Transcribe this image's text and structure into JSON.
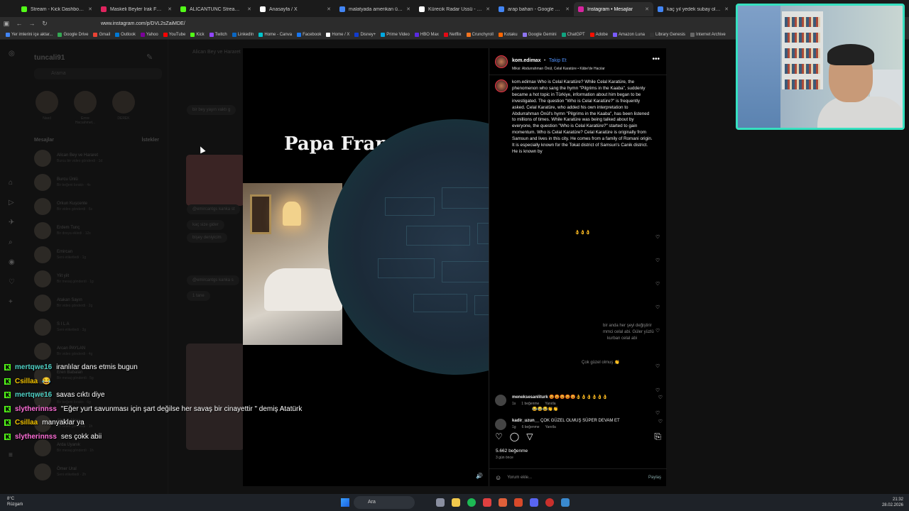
{
  "browser": {
    "tabs": [
      {
        "label": "Stream - Kick Dashboard",
        "color": "#53fc18",
        "active": false
      },
      {
        "label": "Maskeli Beyler Irak Fakir Yar",
        "color": "#e0245e",
        "active": false
      },
      {
        "label": "ALICANTUNC Stream - Wat",
        "color": "#53fc18",
        "active": false
      },
      {
        "label": "Anasayfa / X",
        "color": "#ffffff",
        "active": false
      },
      {
        "label": "malatyada amerikan üssü - Goo",
        "color": "#4285f4",
        "active": false
      },
      {
        "label": "Kürecik Radar Üssü - Vikipedi",
        "color": "#ffffff",
        "active": false
      },
      {
        "label": "arap baharı - Google Search",
        "color": "#4285f4",
        "active": false
      },
      {
        "label": "Instagram • Mesajlar",
        "color": "#d6249f",
        "active": true
      },
      {
        "label": "kaç yıl yedek subay olarak çıkar",
        "color": "#4285f4",
        "active": false
      }
    ],
    "url": "www.instagram.com/p/DVL2sZaiMDE/",
    "bookmarks": [
      "Yer imlerini içe aktar...",
      "Google Drive",
      "Gmail",
      "Outlook",
      "Yahoo",
      "YouTube",
      "Kick",
      "Twitch",
      "LinkedIn",
      "Home - Canva",
      "Facebook",
      "Home / X",
      "Disney+",
      "Prime Video",
      "HBO Max",
      "Netflix",
      "Crunchyroll",
      "Kotaku",
      "Google Gemini",
      "ChatGPT",
      "Adobe",
      "Amazon Luna",
      "Library Genesis",
      "Internet Archive"
    ]
  },
  "inbox": {
    "username": "tuncali91",
    "search_placeholder": "Arama",
    "notes": [
      {
        "label": "Nasıl"
      },
      {
        "label": "Emre Hacıahmet..."
      },
      {
        "label": "DEREK"
      }
    ],
    "messages_header": "Mesajlar",
    "requests_label": "İstekler",
    "chats": [
      {
        "name": "Alican Bey ve Hararet",
        "sub": "Burcu bir video gönderdi · 1d"
      },
      {
        "name": "Burcu Ünlü",
        "sub": "Bir beğeni bıraktı · 4s"
      },
      {
        "name": "Orkun Kuşcente",
        "sub": "Bir video gönderdi · 6s"
      },
      {
        "name": "Erdem Tunç",
        "sub": "Bir dosya ekledi · 12s"
      },
      {
        "name": "Emircan",
        "sub": "Seni etiketledi · 1g"
      },
      {
        "name": "Yiit yiit",
        "sub": "Bir mesaj gönderdi · 1g"
      },
      {
        "name": "Atakan Sayın",
        "sub": "Bir video gönderdi · 2g"
      },
      {
        "name": "S I L A",
        "sub": "Seni etiketledi · 3g"
      },
      {
        "name": "Arcan PAYLAN",
        "sub": "Bir video gönderdi · 4g"
      },
      {
        "name": "Eren Babalan",
        "sub": "Bir mesaj gönderdi · 5g"
      },
      {
        "name": "Hakan",
        "sub": "Bir beğeni bıraktı · 6g"
      },
      {
        "name": "Ahmet Aksu",
        "sub": "Bir video gönderdi · 1h"
      },
      {
        "name": "Arda Uyanık",
        "sub": "Bir mesaj gönderdi · 1h"
      },
      {
        "name": "Ömer Ural",
        "sub": "Seni etiketledi · 2h"
      }
    ]
  },
  "thread": {
    "title": "Alican Bey ve Hararet",
    "bubbles": [
      "bir bey yayın vaktı g",
      "@emircantgs kanka st",
      "kaç size gider",
      "bişey deniyicim",
      "@emircantgs kanka s",
      "1 tane"
    ]
  },
  "video": {
    "overlay_text": "Papa Franc"
  },
  "post": {
    "author": "kom.edimax",
    "follow_label": "Takip Et",
    "music": "Miksi: Abdurrahman Önül, Celal Karatüre • Kâbe'de Hacılar",
    "caption": "kom.edimax Who is Celal Karatüre? While Celal Karatüre, the phenomenon who sang the hymn \"Pilgrims in the Kaaba\", suddenly became a hot topic in Türkiye, information about him began to be investigated. The question \"Who is Celal Karatüre?\" is frequently asked. Celal Karatüre, who added his own interpretation to Abdurrahman Önül's hymn \"Pilgrims in the Kaaba\", has been listened to millions of times. While Karatüre was being talked about by everyone, the question \"Who is Celal Karatüre?\" started to gain momentum. Who is Celal Karatüre? Celal Karatüre is originally from Samsun and lives in this city. He comes from a family of Romani origin. It is especially known for the Tokat district of Samsun's Canik district. He is known by",
    "faded_comments": [
      "👌👌👌",
      "bir anda her şeyi değiştirir",
      "mmci celal abi. Güler yüzlü",
      "kurban celal abi",
      "Çok güzel olmuş 👏",
      "😂😂😂👏👏"
    ],
    "comments": [
      {
        "user": "meneksesanliturk",
        "text": "😡😡😡😡😡👌👌👌👌👌👌",
        "meta": "1s",
        "likes": "1 beğenme",
        "reply": "Yanıtla"
      },
      {
        "user": "kadir_uzun__",
        "text": "ÇOK GÜZEL OLMUŞ SÜPER DEVAM ET",
        "meta": "1g",
        "likes": "6 beğenme",
        "reply": "Yanıtla"
      }
    ],
    "likes": "5.662 beğenme",
    "time_ago": "3 gün önce",
    "comment_placeholder": "Yorum ekle...",
    "share_label": "Paylaş"
  },
  "stream_chat": [
    {
      "user": "mertqwe16",
      "color": "#4fd1c5",
      "text": "iranlılar dans etmis bugun"
    },
    {
      "user": "Csillaa",
      "color": "#f2c200",
      "text": "😂"
    },
    {
      "user": "mertqwe16",
      "color": "#4fd1c5",
      "text": "savas cıktı diye"
    },
    {
      "user": "slytherinnss",
      "color": "#ff6fd8",
      "text": "\"Eğer yurt savunması için şart değilse her savaş bir cinayettir \" demiş Atatürk"
    },
    {
      "user": "Csillaa",
      "color": "#f2c200",
      "text": "manyaklar ya"
    },
    {
      "user": "slytherinnss",
      "color": "#ff6fd8",
      "text": "ses çokk abii"
    }
  ],
  "taskbar": {
    "weather_temp": "8°C",
    "weather_place": "Rüzgarlı",
    "search_label": "Ara",
    "time": "21:32",
    "date": "28.02.2026"
  }
}
